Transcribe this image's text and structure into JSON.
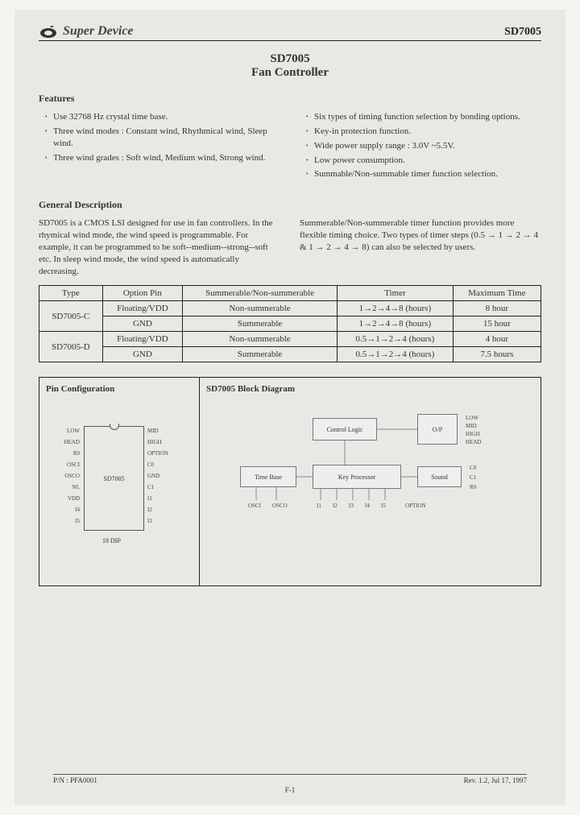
{
  "brand": {
    "name": "Super Device"
  },
  "part_number": "SD7005",
  "title": {
    "line1": "SD7005",
    "line2": "Fan Controller"
  },
  "sections": {
    "features": "Features",
    "general": "General Description",
    "pinconf": "Pin Configuration",
    "blockdiag": "SD7005 Block Diagram"
  },
  "features_left": [
    "Use 32768 Hz crystal time base.",
    "Three wind modes : Constant wind, Rhythmical wind, Sleep wind.",
    "Three wind grades : Soft wind, Medium wind, Strong wind."
  ],
  "features_right": [
    "Six types of timing function selection by bonding options.",
    "Key-in protection function.",
    "Wide power supply range : 3.0V ~5.5V.",
    "Low power consumption.",
    "Summable/Non-summable timer function selection."
  ],
  "general_left": "SD7005 is a CMOS LSI designed for use in fan controllers. In the rhymical wind mode, the wind speed is programmable. For example, it can be programmed to be soft--medium--strong--soft etc. In sleep wind mode, the wind speed is automatically decreasing.",
  "general_right": "Summerable/Non-summerable timer function provides more flexible timing choice. Two types of timer steps (0.5 → 1 → 2 → 4 & 1 → 2 → 4 → 8) can also be selected by users.",
  "table": {
    "headers": [
      "Type",
      "Option Pin",
      "Summerable/Non-summerable",
      "Timer",
      "Maximum Time"
    ],
    "rows": [
      {
        "type": "SD7005-C",
        "opt": "Floating/VDD",
        "sum": "Non-summerable",
        "timer": "1→2→4→8     (hours)",
        "max": "8 hour"
      },
      {
        "type": "",
        "opt": "GND",
        "sum": "Summerable",
        "timer": "1→2→4→8     (hours)",
        "max": "15 hour"
      },
      {
        "type": "SD7005-D",
        "opt": "Floating/VDD",
        "sum": "Non-summerable",
        "timer": "0.5→1→2→4   (hours)",
        "max": "4 hour"
      },
      {
        "type": "",
        "opt": "GND",
        "sum": "Summerable",
        "timer": "0.5→1→2→4   (hours)",
        "max": "7.5 hours"
      }
    ]
  },
  "pins": {
    "left": [
      "LOW",
      "HEAD",
      "R0",
      "OSCI",
      "OSCO",
      "NL",
      "VDD",
      "I4",
      "I5"
    ],
    "right": [
      "MID",
      "HIGH",
      "OPTION",
      "C0",
      "GND",
      "C1",
      "I1",
      "I2",
      "I3"
    ],
    "chip": "SD7005",
    "package": "18 DIP"
  },
  "blocks": {
    "control": "Control Logic",
    "op": "O/P",
    "timebase": "Time Base",
    "keyproc": "Key Processor",
    "sound": "Sound",
    "out": [
      "LOW",
      "MID",
      "HIGH",
      "HEAD"
    ],
    "right": [
      "C0",
      "C1",
      "R0"
    ],
    "bottom": [
      "OSCI",
      "OSCO",
      "I1",
      "I2",
      "I3",
      "I4",
      "I5",
      "OPTION"
    ]
  },
  "footer": {
    "left": "P/N : PFA0001",
    "right": "Rev. 1.2, Jul 17, 1997",
    "page": "F-1"
  }
}
